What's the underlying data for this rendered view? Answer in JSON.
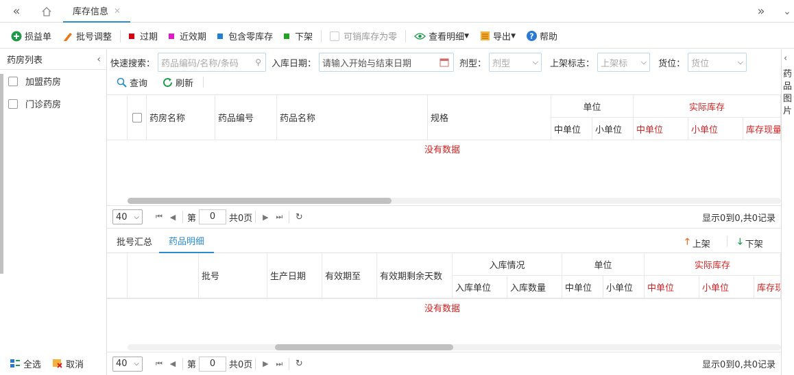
{
  "tabs": {
    "active_label": "库存信息"
  },
  "toolbar": {
    "loss_label": "损益单",
    "batch_adjust_label": "批号调整",
    "expired_label": "过期",
    "near_expiry_label": "近效期",
    "include_zero_label": "包含零库存",
    "off_shelf_label": "下架",
    "sellable_zero_label": "可销库存为零",
    "view_detail_label": "查看明细",
    "export_label": "导出",
    "help_label": "帮助",
    "colors": {
      "expired": "#d9000d",
      "near_expiry": "#e219c8",
      "include_zero": "#1f7fd8",
      "off_shelf": "#1fa51f"
    }
  },
  "sidebar": {
    "title": "药房列表",
    "items": [
      {
        "label": "加盟药房"
      },
      {
        "label": "门诊药房"
      }
    ],
    "select_all_label": "全选",
    "cancel_label": "取消"
  },
  "filters": {
    "quick_search_label": "快速搜索：",
    "quick_search_placeholder": "药品编码/名称/条码",
    "in_date_label": "入库日期：",
    "in_date_placeholder": "请输入开始与结束日期",
    "dosage_label": "剂型：",
    "dosage_placeholder": "剂型",
    "shelf_flag_label": "上架标志：",
    "shelf_flag_placeholder": "上架标",
    "location_label": "货位：",
    "location_placeholder": "货位",
    "query_label": "查询",
    "refresh_label": "刷新"
  },
  "grid1": {
    "headers": {
      "pharmacy": "药房名称",
      "drug_code": "药品编号",
      "drug_name": "药品名称",
      "spec": "规格",
      "unit": "单位",
      "mid_unit": "中单位",
      "small_unit": "小单位",
      "actual_stock": "实际库存",
      "act_mid": "中单位",
      "act_small": "小单位",
      "stock_now": "库存现量"
    },
    "no_data": "没有数据",
    "pager": {
      "page_size": "40",
      "page_prefix": "第",
      "page_value": "0",
      "page_suffix": "共0页",
      "summary": "显示0到0,共0记录"
    }
  },
  "subtabs": {
    "batch_summary": "批号汇总",
    "drug_detail": "药品明细",
    "shelve_label": "上架",
    "unshelve_label": "下架"
  },
  "grid2": {
    "headers": {
      "batch": "批号",
      "prod_date": "生产日期",
      "valid_to": "有效期至",
      "remain_days": "有效期剩余天数",
      "in_info": "入库情况",
      "in_unit": "入库单位",
      "in_qty": "入库数量",
      "unit": "单位",
      "mid_unit": "中单位",
      "small_unit": "小单位",
      "actual_stock": "实际库存",
      "act_mid": "中单位",
      "act_small": "小单位",
      "stock_now": "库存现"
    },
    "no_data": "没有数据",
    "pager": {
      "page_size": "40",
      "page_prefix": "第",
      "page_value": "0",
      "page_suffix": "共0页",
      "summary": "显示0到0,共0记录"
    }
  },
  "rightbar": {
    "label": "药品图片"
  }
}
